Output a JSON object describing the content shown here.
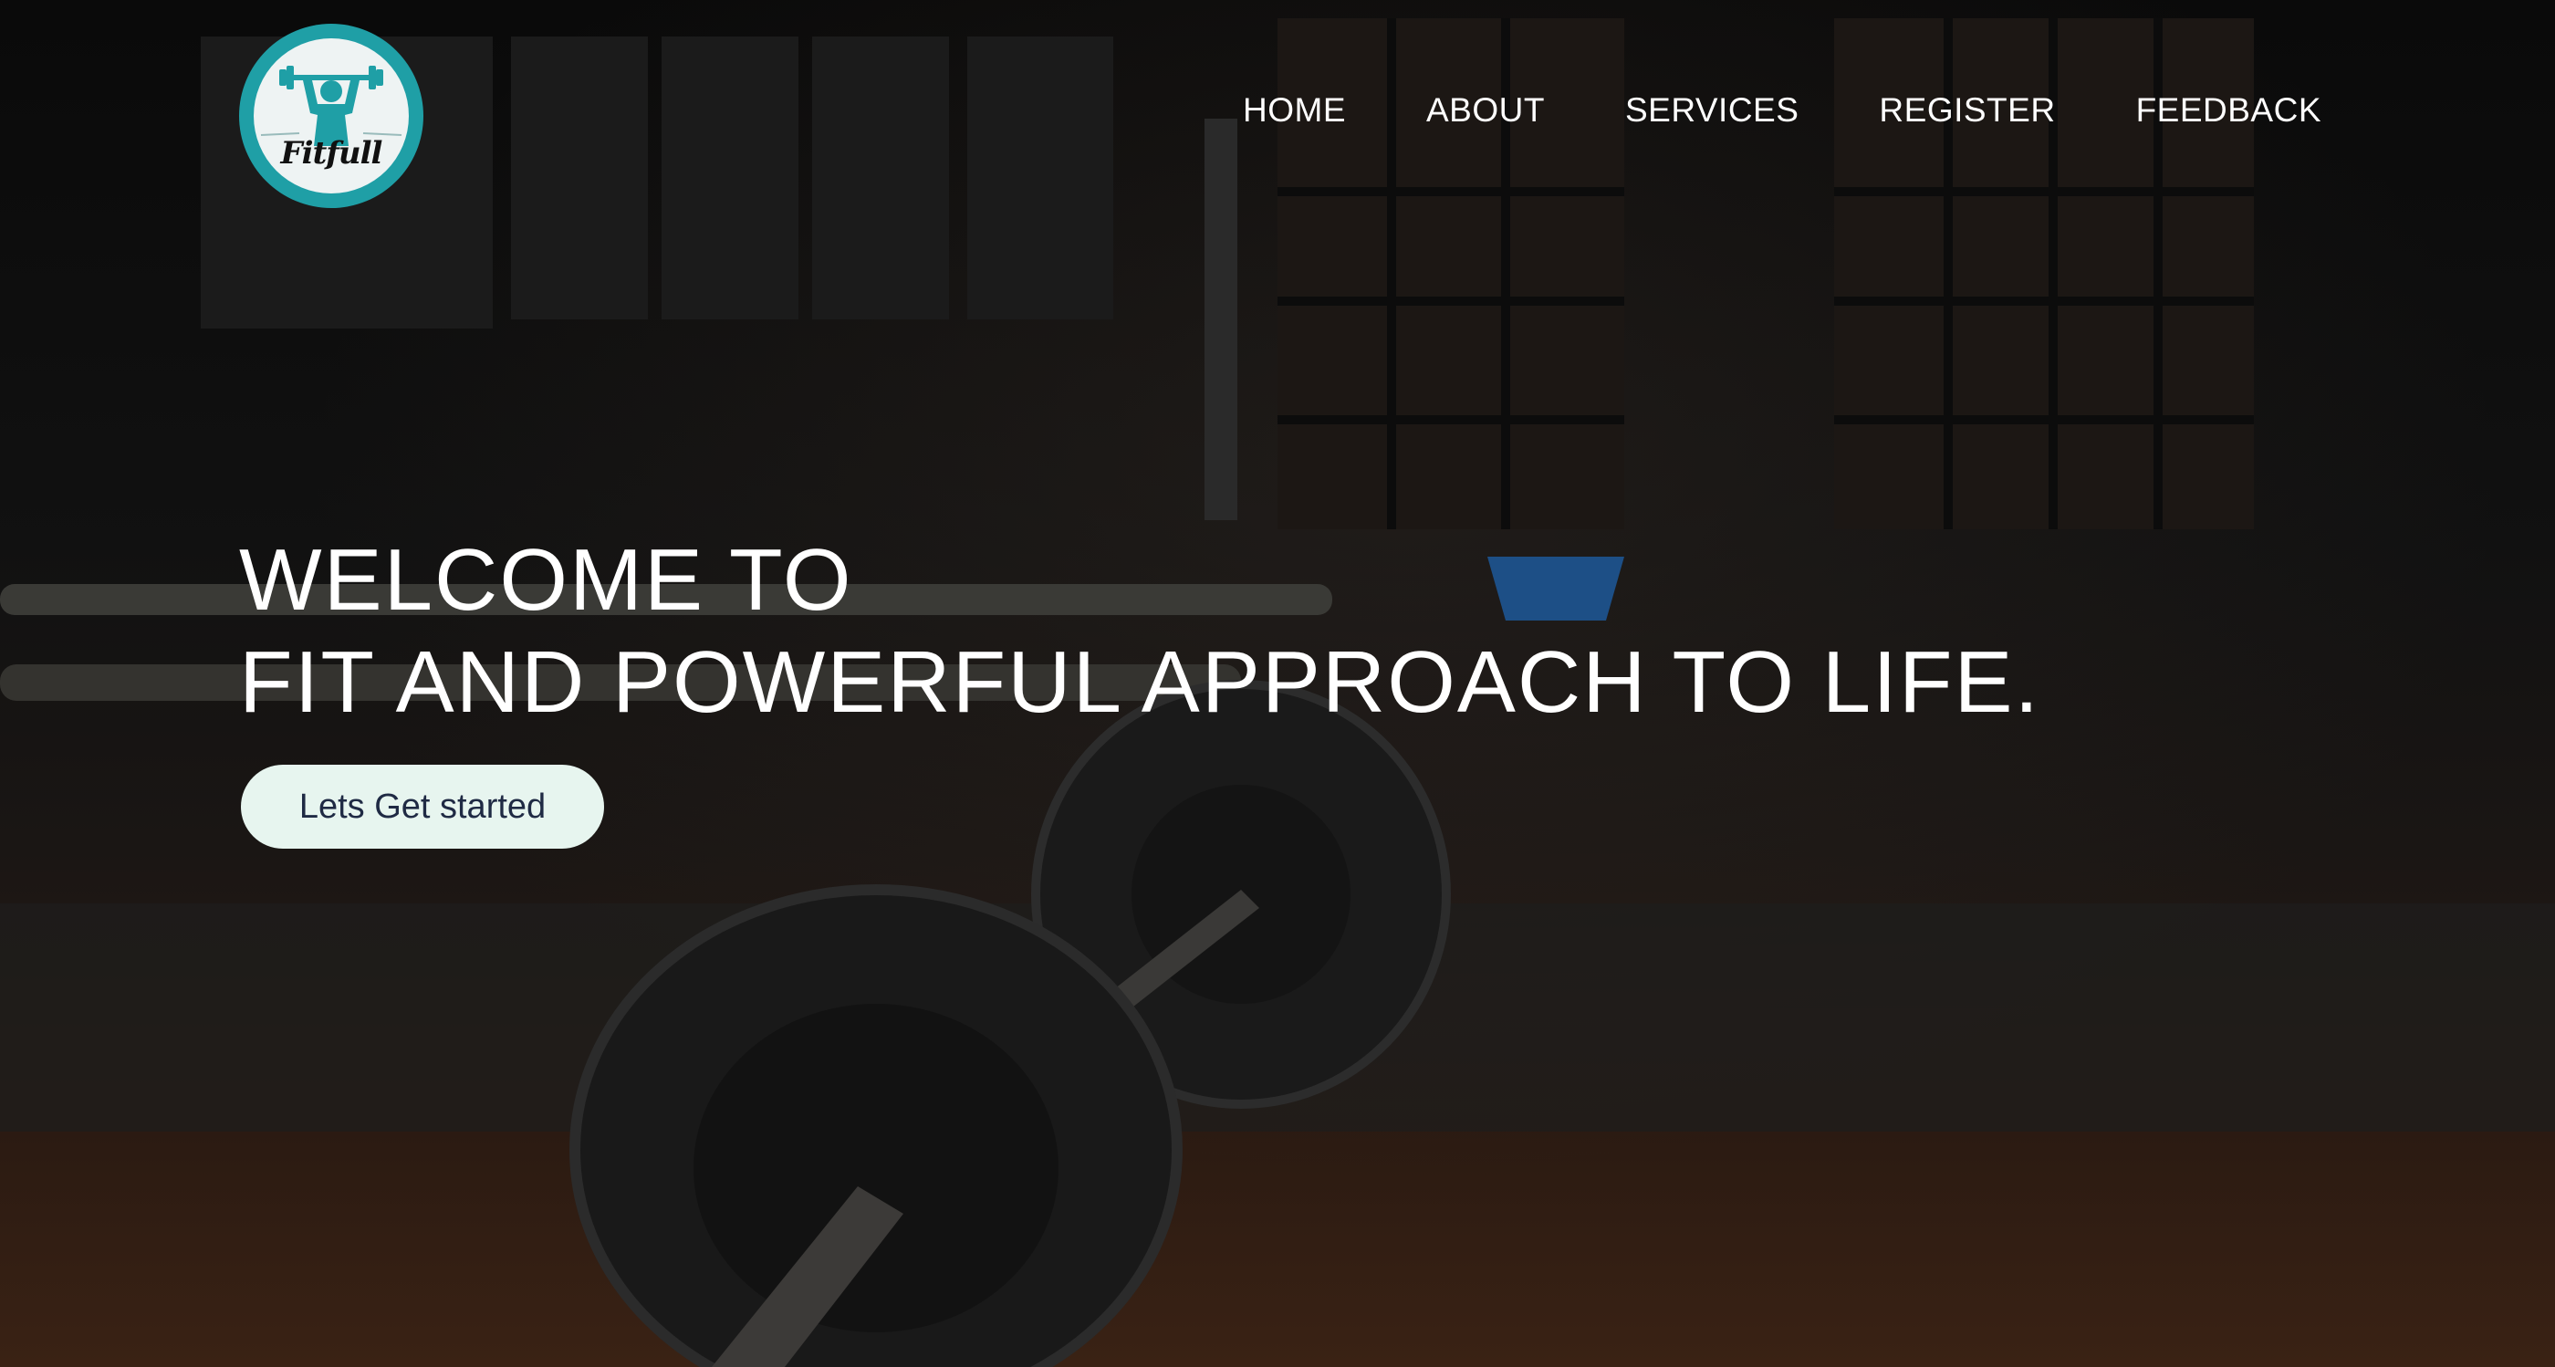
{
  "brand": {
    "logo_text": "Fitfull",
    "logo_icon": "weightlifter-icon",
    "accent": "#1f9fa6"
  },
  "nav": {
    "items": [
      {
        "label": "HOME"
      },
      {
        "label": "ABOUT"
      },
      {
        "label": "SERVICES"
      },
      {
        "label": "REGISTER"
      },
      {
        "label": "FEEDBACK"
      }
    ]
  },
  "hero": {
    "line1": "WELCOME TO",
    "line2": "FIT AND POWERFUL APPROACH TO LIFE.",
    "cta_label": "Lets Get started",
    "cta_color": "#e7f5ef"
  }
}
